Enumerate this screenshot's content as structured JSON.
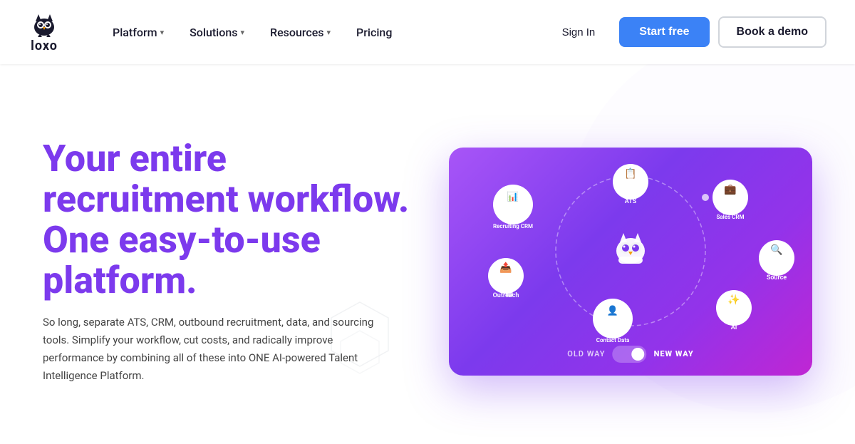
{
  "navbar": {
    "logo_text": "loxo",
    "nav_items": [
      {
        "label": "Platform",
        "has_dropdown": true
      },
      {
        "label": "Solutions",
        "has_dropdown": true
      },
      {
        "label": "Resources",
        "has_dropdown": true
      },
      {
        "label": "Pricing",
        "has_dropdown": false
      }
    ],
    "sign_in_label": "Sign In",
    "start_free_label": "Start free",
    "book_demo_label": "Book a demo"
  },
  "hero": {
    "headline": "Your entire recruitment workflow. One easy-to-use platform.",
    "subtext": "So long, separate ATS, CRM, outbound recruitment, data, and sourcing tools. Simplify your workflow, cut costs, and radically improve performance by combining all of these into ONE AI-powered Talent Intelligence Platform."
  },
  "diagram": {
    "nodes": [
      {
        "label": "ATS",
        "icon": "📋",
        "angle": 90
      },
      {
        "label": "Sales CRM",
        "icon": "💼",
        "angle": 30
      },
      {
        "label": "Source",
        "icon": "🔍",
        "angle": 330
      },
      {
        "label": "AI",
        "icon": "✨",
        "angle": 270
      },
      {
        "label": "Contact Data",
        "icon": "👤",
        "angle": 220
      },
      {
        "label": "Outreach",
        "icon": "📤",
        "angle": 170
      },
      {
        "label": "Recruiting CRM",
        "icon": "📊",
        "angle": 130
      }
    ],
    "toggle_old": "OLD WAY",
    "toggle_new": "NEW WAY"
  },
  "colors": {
    "purple_primary": "#7c3aed",
    "purple_light": "#a855f7",
    "blue_button": "#3b82f6"
  }
}
